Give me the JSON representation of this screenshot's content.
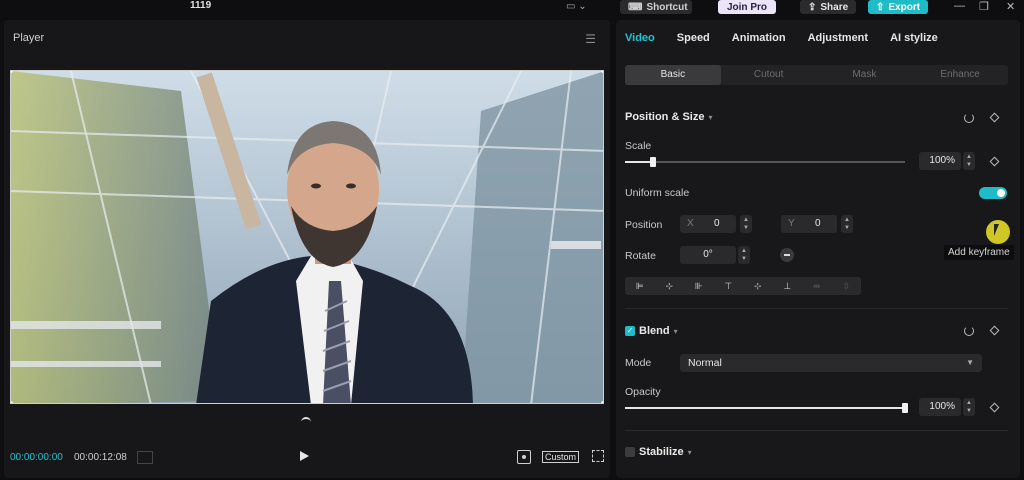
{
  "topbar": {
    "title": "1119",
    "shortcut_label": "Shortcut",
    "joinpro_label": "Join Pro",
    "share_label": "Share",
    "export_label": "Export"
  },
  "player": {
    "title": "Player",
    "time_current": "00:00:00:00",
    "time_total": "00:00:12:08",
    "ratio_label": "Custom"
  },
  "properties": {
    "tabs": [
      {
        "label": "Video",
        "active": true
      },
      {
        "label": "Speed"
      },
      {
        "label": "Animation"
      },
      {
        "label": "Adjustment"
      },
      {
        "label": "AI stylize"
      }
    ],
    "subtabs": [
      {
        "label": "Basic",
        "active": true
      },
      {
        "label": "Cutout"
      },
      {
        "label": "Mask"
      },
      {
        "label": "Enhance"
      }
    ],
    "position_size": {
      "title": "Position & Size",
      "scale_label": "Scale",
      "scale_value": "100%",
      "scale_fraction": 0.1,
      "uniform_scale_label": "Uniform scale",
      "uniform_scale_on": true,
      "position_label": "Position",
      "x_axis": "X",
      "x_value": "0",
      "y_axis": "Y",
      "y_value": "0",
      "rotate_label": "Rotate",
      "rotate_value": "0°"
    },
    "blend": {
      "title": "Blend",
      "enabled": true,
      "mode_label": "Mode",
      "mode_value": "Normal",
      "opacity_label": "Opacity",
      "opacity_value": "100%",
      "opacity_fraction": 1.0
    },
    "stabilize": {
      "title": "Stabilize",
      "enabled": false
    }
  },
  "tooltip": "Add keyframe",
  "colors": {
    "accent": "#1fbcc8",
    "background": "#0e0e10",
    "panel": "#18181a"
  }
}
